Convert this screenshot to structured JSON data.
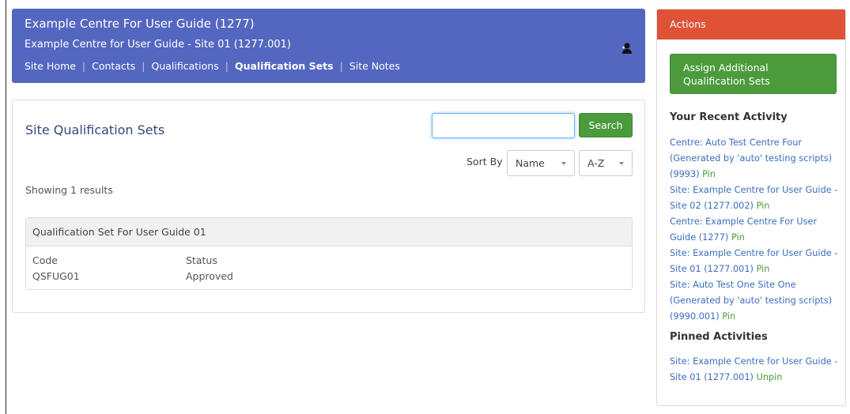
{
  "header": {
    "centre_title": "Example Centre For User Guide (1277)",
    "site_title": "Example Centre for User Guide - Site 01 (1277.001)",
    "nav": [
      {
        "label": "Site Home"
      },
      {
        "label": "Contacts"
      },
      {
        "label": "Qualifications"
      },
      {
        "label": "Qualification Sets"
      },
      {
        "label": "Site Notes"
      }
    ],
    "active_nav": "Qualification Sets",
    "user_icon": "user-silhouette-icon",
    "bg_color": "#5467c0"
  },
  "main": {
    "title": "Site Qualification Sets",
    "search": {
      "value": "",
      "button_label": "Search"
    },
    "sort": {
      "label": "Sort By",
      "field": "Name",
      "order": "A-Z"
    },
    "results_text": "Showing 1 results",
    "qualification_sets": [
      {
        "name": "Qualification Set For User Guide 01",
        "code_label": "Code",
        "code": "QSFUG01",
        "status_label": "Status",
        "status": "Approved"
      }
    ]
  },
  "actions": {
    "title": "Actions",
    "assign_button_line1": "Assign Additional",
    "assign_button_line2": "Qualification Sets",
    "recent_heading": "Your Recent Activity",
    "recent": [
      {
        "text": "Centre: Auto Test Centre Four (Generated by 'auto' testing scripts) (9993)",
        "pin": "Pin"
      },
      {
        "text": "Site: Example Centre for User Guide - Site 02 (1277.002)",
        "pin": "Pin"
      },
      {
        "text": "Centre: Example Centre For User Guide (1277)",
        "pin": "Pin"
      },
      {
        "text": "Site: Example Centre for User Guide - Site 01 (1277.001)",
        "pin": "Pin"
      },
      {
        "text": "Site: Auto Test One Site One (Generated by 'auto' testing scripts) (9990.001)",
        "pin": "Pin"
      }
    ],
    "pinned_heading": "Pinned Activities",
    "pinned": [
      {
        "text": "Site: Example Centre for User Guide - Site 01 (1277.001)",
        "pin": "Unpin"
      }
    ],
    "header_color": "#df5235",
    "button_color": "#4b9b3c",
    "link_color": "#3b6dbf"
  }
}
